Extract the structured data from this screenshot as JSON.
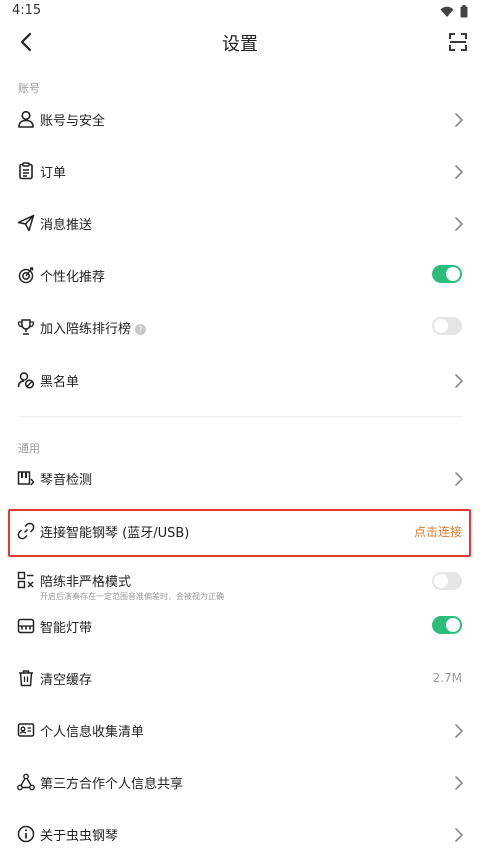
{
  "status_bar": {
    "time": "4:15"
  },
  "header": {
    "title": "设置"
  },
  "sections": [
    {
      "title": "账号"
    },
    {
      "title": "通用"
    }
  ],
  "rows": {
    "account_security": {
      "label": "账号与安全"
    },
    "orders": {
      "label": "订单"
    },
    "notifications": {
      "label": "消息推送"
    },
    "personalized": {
      "label": "个性化推荐",
      "toggle": true
    },
    "leaderboard": {
      "label": "加入陪练排行榜",
      "help": "?",
      "toggle": false
    },
    "blacklist": {
      "label": "黑名单"
    },
    "pitch_detection": {
      "label": "琴音检测"
    },
    "connect_piano": {
      "label": "连接智能钢琴 (蓝牙/USB)",
      "action": "点击连接",
      "action_color": "#e07a2c"
    },
    "lenient_mode": {
      "label": "陪练非严格模式",
      "sublabel": "开启后演奏存在一定范围音准偏差时，会被视为正确",
      "toggle": false
    },
    "light_strip": {
      "label": "智能灯带",
      "toggle": true
    },
    "clear_cache": {
      "label": "清空缓存",
      "value": "2.7M"
    },
    "personal_info": {
      "label": "个人信息收集清单"
    },
    "third_party": {
      "label": "第三方合作个人信息共享"
    },
    "about": {
      "label": "关于虫虫钢琴"
    }
  },
  "colors": {
    "toggle_on": "#2bbd7b",
    "toggle_off": "#e5e5e5",
    "highlight": "#e53935"
  }
}
